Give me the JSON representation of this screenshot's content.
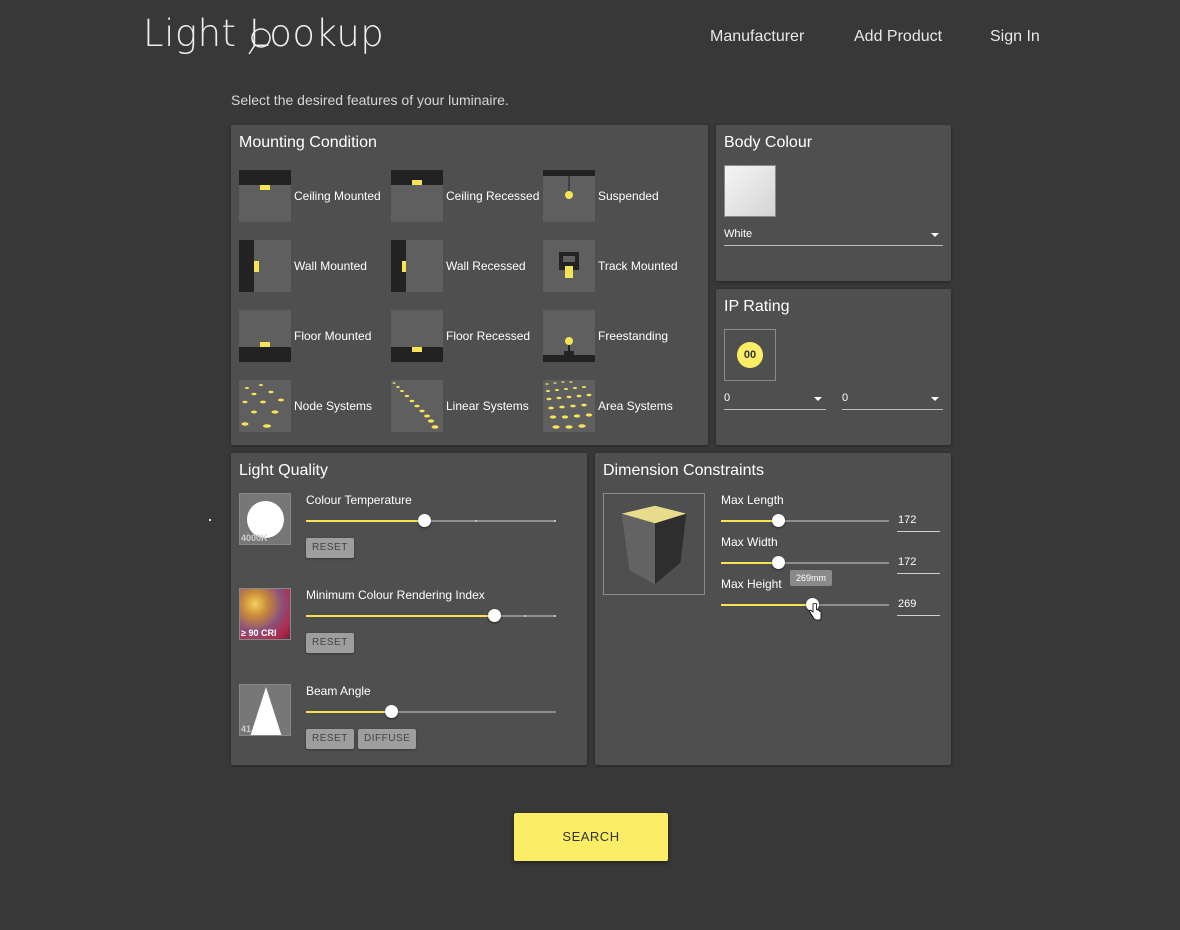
{
  "header": {
    "logo_text": "Light Lookup",
    "nav": [
      "Manufacturer",
      "Add Product",
      "Sign In"
    ]
  },
  "subtitle": "Select the desired features of your luminaire.",
  "mounting": {
    "title": "Mounting Condition",
    "items": [
      {
        "label": "Ceiling Mounted",
        "icon": "ceiling-mounted-icon"
      },
      {
        "label": "Ceiling Recessed",
        "icon": "ceiling-recessed-icon"
      },
      {
        "label": "Suspended",
        "icon": "suspended-icon"
      },
      {
        "label": "Wall Mounted",
        "icon": "wall-mounted-icon"
      },
      {
        "label": "Wall Recessed",
        "icon": "wall-recessed-icon"
      },
      {
        "label": "Track Mounted",
        "icon": "track-mounted-icon"
      },
      {
        "label": "Floor Mounted",
        "icon": "floor-mounted-icon"
      },
      {
        "label": "Floor Recessed",
        "icon": "floor-recessed-icon"
      },
      {
        "label": "Freestanding",
        "icon": "freestanding-icon"
      },
      {
        "label": "Node Systems",
        "icon": "node-systems-icon"
      },
      {
        "label": "Linear Systems",
        "icon": "linear-systems-icon"
      },
      {
        "label": "Area Systems",
        "icon": "area-systems-icon"
      }
    ]
  },
  "body_colour": {
    "title": "Body Colour",
    "selected": "White",
    "swatch_color": "#e6e6e6"
  },
  "ip_rating": {
    "title": "IP Rating",
    "badge": "00",
    "first_digit": "0",
    "second_digit": "0"
  },
  "light_quality": {
    "title": "Light Quality",
    "colour_temperature": {
      "name": "Colour Temperature",
      "thumb_label": "4000K",
      "value_fraction": 0.47,
      "reset": "RESET"
    },
    "cri": {
      "name": "Minimum Colour Rendering Index",
      "thumb_label": "≥ 90 CRI",
      "value_fraction": 0.75,
      "reset": "RESET"
    },
    "beam_angle": {
      "name": "Beam Angle",
      "thumb_label": "41",
      "value_fraction": 0.34,
      "reset": "RESET",
      "diffuse": "DIFFUSE"
    }
  },
  "dimensions": {
    "title": "Dimension Constraints",
    "max_length": {
      "label": "Max Length",
      "value": "172",
      "fraction": 0.34
    },
    "max_width": {
      "label": "Max Width",
      "value": "172",
      "fraction": 0.34
    },
    "max_height": {
      "label": "Max Height",
      "value": "269",
      "fraction": 0.54,
      "tooltip": "269mm"
    }
  },
  "search_label": "SEARCH",
  "colors": {
    "accent": "#f5e455",
    "panel": "#4f4f4f",
    "background": "#383838"
  }
}
